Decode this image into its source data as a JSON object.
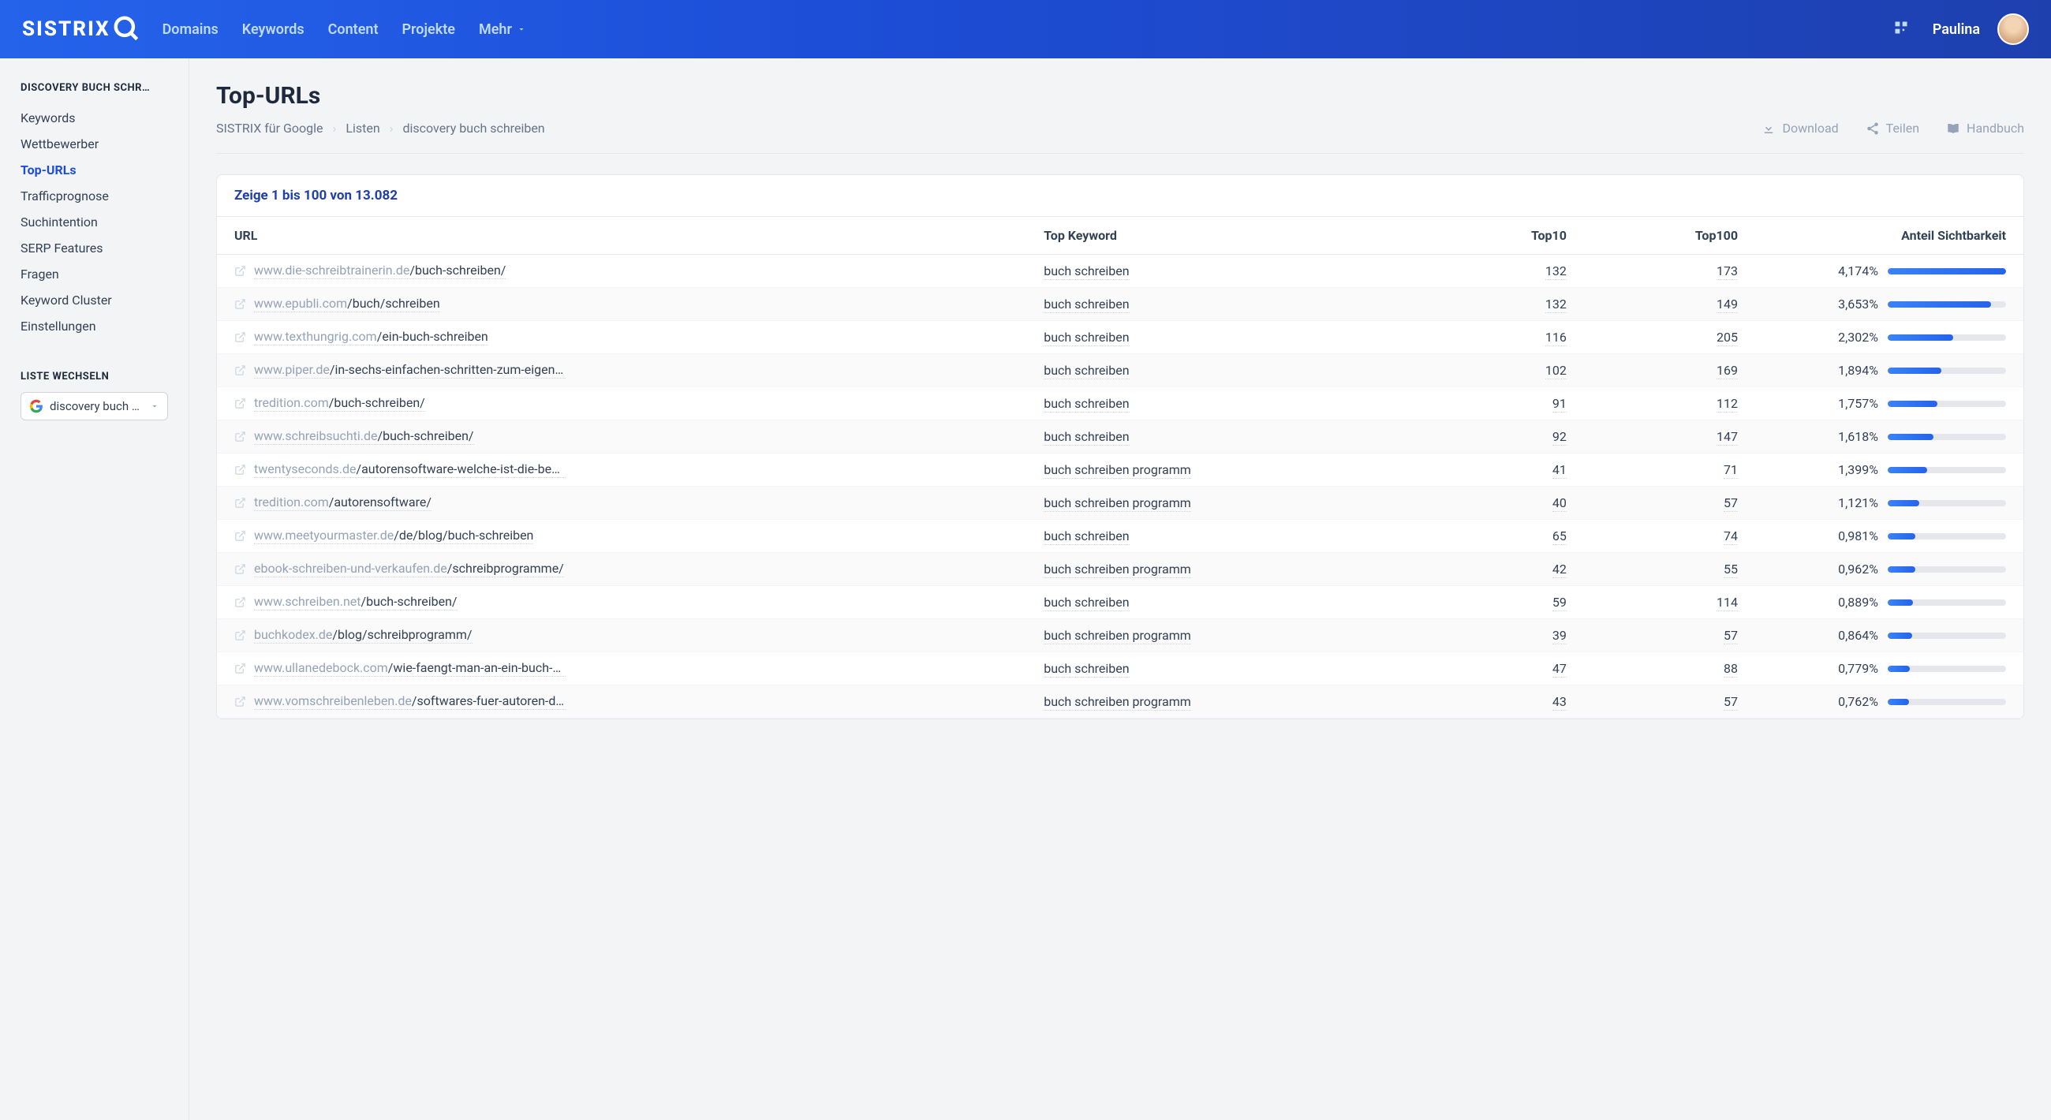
{
  "topnav": {
    "logo_text": "SISTRIX",
    "links": [
      "Domains",
      "Keywords",
      "Content",
      "Projekte",
      "Mehr"
    ],
    "username": "Paulina"
  },
  "sidebar": {
    "heading": "DISCOVERY BUCH SCHR…",
    "items": [
      {
        "label": "Keywords",
        "active": false
      },
      {
        "label": "Wettbewerber",
        "active": false
      },
      {
        "label": "Top-URLs",
        "active": true
      },
      {
        "label": "Trafficprognose",
        "active": false
      },
      {
        "label": "Suchintention",
        "active": false
      },
      {
        "label": "SERP Features",
        "active": false
      },
      {
        "label": "Fragen",
        "active": false
      },
      {
        "label": "Keyword Cluster",
        "active": false
      },
      {
        "label": "Einstellungen",
        "active": false
      }
    ],
    "switch_label": "LISTE WECHSELN",
    "switch_value": "discovery buch s…"
  },
  "page": {
    "title": "Top-URLs",
    "breadcrumb": [
      "SISTRIX für Google",
      "Listen",
      "discovery buch schreiben"
    ],
    "actions": {
      "download": "Download",
      "share": "Teilen",
      "manual": "Handbuch"
    }
  },
  "table": {
    "summary": "Zeige 1 bis 100 von 13.082",
    "columns": {
      "url": "URL",
      "keyword": "Top Keyword",
      "top10": "Top10",
      "top100": "Top100",
      "visibility": "Anteil Sichtbarkeit"
    },
    "max_visibility_pct": 4.174,
    "rows": [
      {
        "host": "www.die-schreibtrainerin.de",
        "path": "/buch-schreiben/",
        "keyword": "buch schreiben",
        "top10": 132,
        "top100": 173,
        "visibility": "4,174%",
        "visibility_pct": 4.174
      },
      {
        "host": "www.epubli.com",
        "path": "/buch/schreiben",
        "keyword": "buch schreiben",
        "top10": 132,
        "top100": 149,
        "visibility": "3,653%",
        "visibility_pct": 3.653
      },
      {
        "host": "www.texthungrig.com",
        "path": "/ein-buch-schreiben",
        "keyword": "buch schreiben",
        "top10": 116,
        "top100": 205,
        "visibility": "2,302%",
        "visibility_pct": 2.302
      },
      {
        "host": "www.piper.de",
        "path": "/in-sechs-einfachen-schritten-zum-eigene…",
        "keyword": "buch schreiben",
        "top10": 102,
        "top100": 169,
        "visibility": "1,894%",
        "visibility_pct": 1.894
      },
      {
        "host": "tredition.com",
        "path": "/buch-schreiben/",
        "keyword": "buch schreiben",
        "top10": 91,
        "top100": 112,
        "visibility": "1,757%",
        "visibility_pct": 1.757
      },
      {
        "host": "www.schreibsuchti.de",
        "path": "/buch-schreiben/",
        "keyword": "buch schreiben",
        "top10": 92,
        "top100": 147,
        "visibility": "1,618%",
        "visibility_pct": 1.618
      },
      {
        "host": "twentyseconds.de",
        "path": "/autorensoftware-welche-ist-die-best…",
        "keyword": "buch schreiben programm",
        "top10": 41,
        "top100": 71,
        "visibility": "1,399%",
        "visibility_pct": 1.399
      },
      {
        "host": "tredition.com",
        "path": "/autorensoftware/",
        "keyword": "buch schreiben programm",
        "top10": 40,
        "top100": 57,
        "visibility": "1,121%",
        "visibility_pct": 1.121
      },
      {
        "host": "www.meetyourmaster.de",
        "path": "/de/blog/buch-schreiben",
        "keyword": "buch schreiben",
        "top10": 65,
        "top100": 74,
        "visibility": "0,981%",
        "visibility_pct": 0.981
      },
      {
        "host": "ebook-schreiben-und-verkaufen.de",
        "path": "/schreibprogramme/",
        "keyword": "buch schreiben programm",
        "top10": 42,
        "top100": 55,
        "visibility": "0,962%",
        "visibility_pct": 0.962
      },
      {
        "host": "www.schreiben.net",
        "path": "/buch-schreiben/",
        "keyword": "buch schreiben",
        "top10": 59,
        "top100": 114,
        "visibility": "0,889%",
        "visibility_pct": 0.889
      },
      {
        "host": "buchkodex.de",
        "path": "/blog/schreibprogramm/",
        "keyword": "buch schreiben programm",
        "top10": 39,
        "top100": 57,
        "visibility": "0,864%",
        "visibility_pct": 0.864
      },
      {
        "host": "www.ullanedebock.com",
        "path": "/wie-faengt-man-an-ein-buch-zu…",
        "keyword": "buch schreiben",
        "top10": 47,
        "top100": 88,
        "visibility": "0,779%",
        "visibility_pct": 0.779
      },
      {
        "host": "www.vomschreibenleben.de",
        "path": "/softwares-fuer-autoren-die…",
        "keyword": "buch schreiben programm",
        "top10": 43,
        "top100": 57,
        "visibility": "0,762%",
        "visibility_pct": 0.762
      }
    ]
  }
}
